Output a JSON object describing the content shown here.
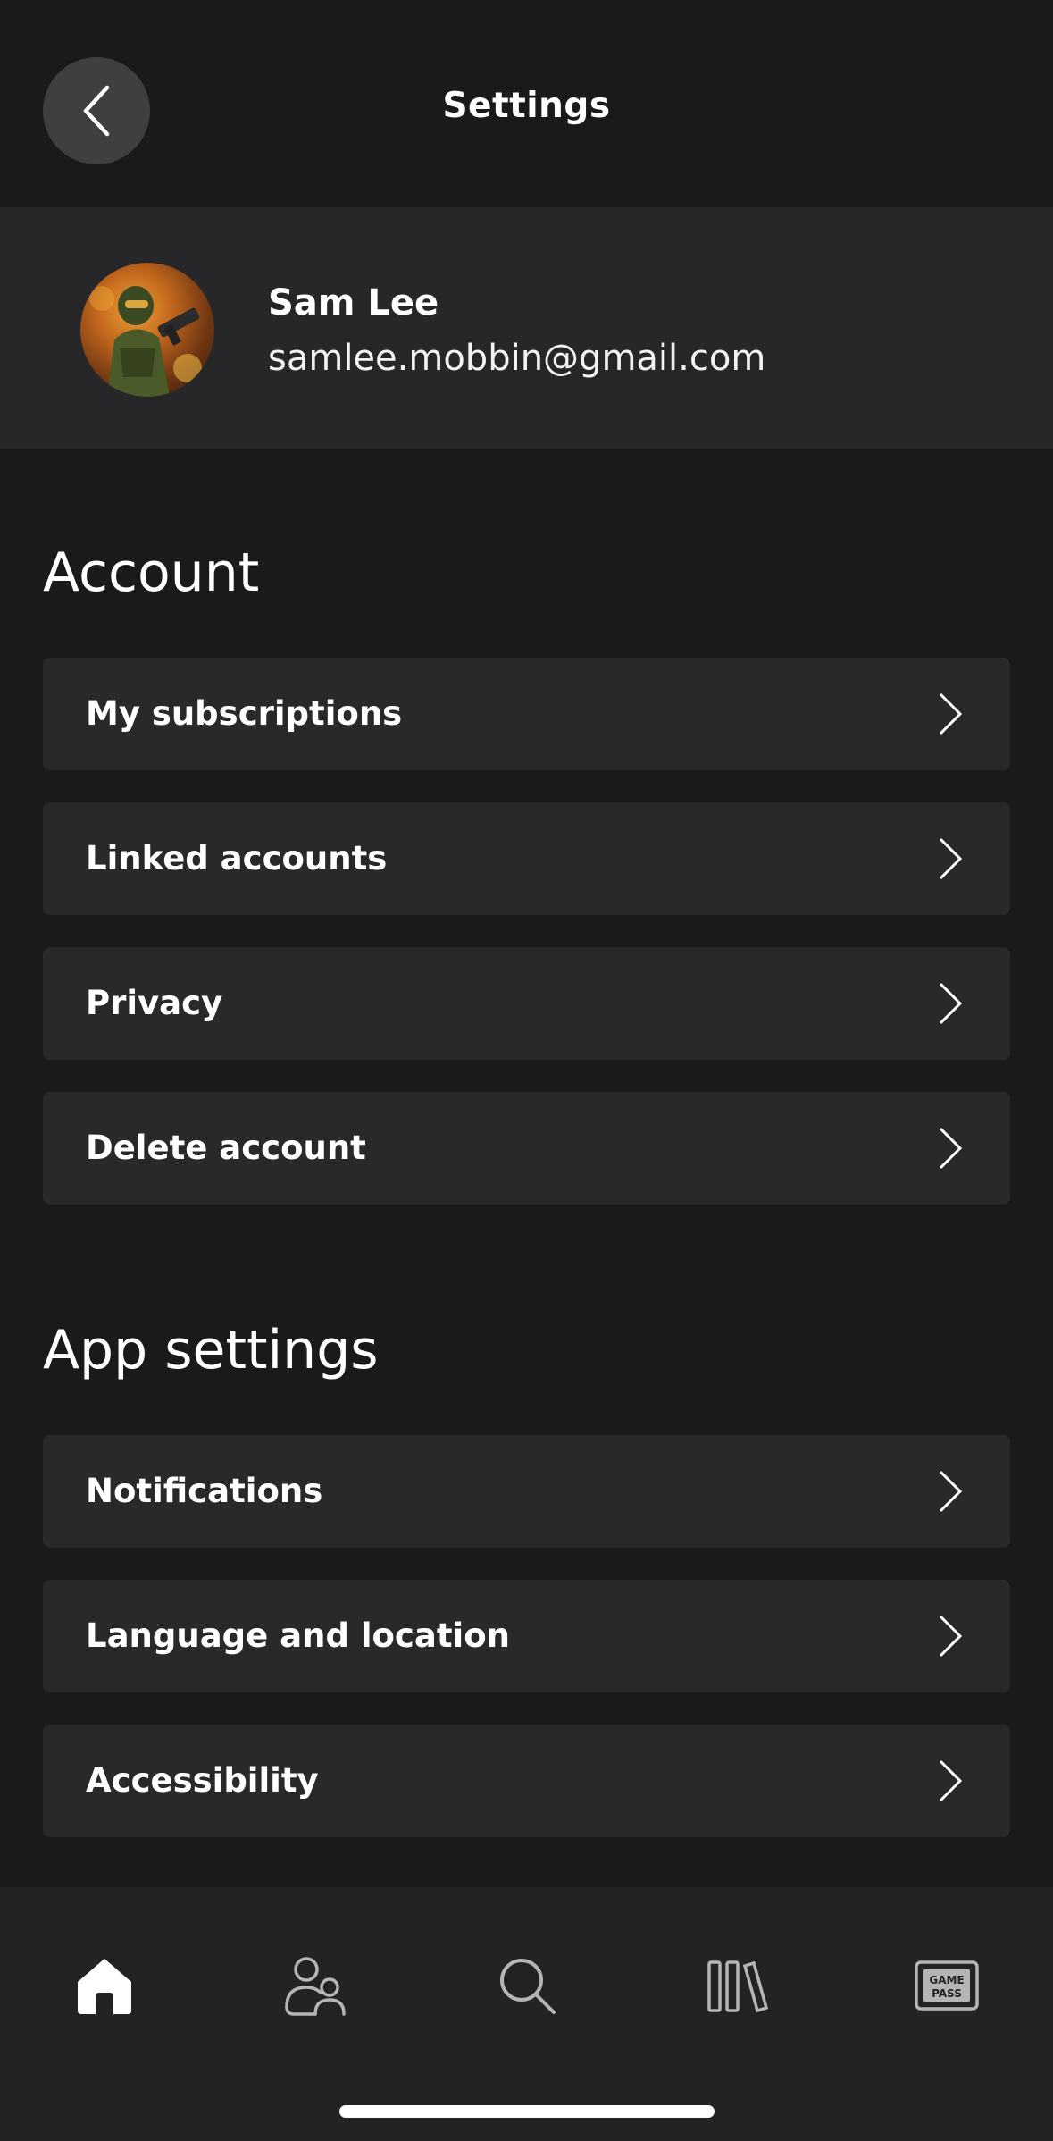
{
  "header": {
    "title": "Settings"
  },
  "profile": {
    "name": "Sam Lee",
    "email": "samlee.mobbin@gmail.com"
  },
  "account": {
    "title": "Account",
    "items": [
      {
        "label": "My subscriptions"
      },
      {
        "label": "Linked accounts"
      },
      {
        "label": "Privacy"
      },
      {
        "label": "Delete account"
      }
    ]
  },
  "app_settings": {
    "title": "App settings",
    "items": [
      {
        "label": "Notifications"
      },
      {
        "label": "Language and location"
      },
      {
        "label": "Accessibility"
      }
    ]
  },
  "nav": {
    "items": [
      {
        "icon": "home-icon",
        "active": true
      },
      {
        "icon": "friends-icon",
        "active": false
      },
      {
        "icon": "search-icon",
        "active": false
      },
      {
        "icon": "library-icon",
        "active": false
      },
      {
        "icon": "game-pass-icon",
        "active": false,
        "badge_text": "GAME PASS"
      }
    ]
  },
  "colors": {
    "background": "#1a1a1b",
    "card": "#29292c",
    "profile_band": "#27272a",
    "nav_bar": "#232325",
    "text": "#ffffff",
    "inactive_icon": "#b5b5b8"
  }
}
